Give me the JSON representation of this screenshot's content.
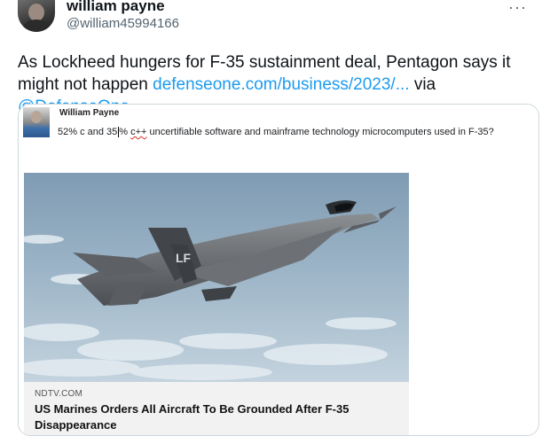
{
  "author": {
    "display_name": "william payne",
    "handle": "@william45994166",
    "more_label": "···"
  },
  "tweet": {
    "text_before": "As Lockheed hungers for F-35 sustainment deal, Pentagon says it might not happen ",
    "link_text": "defenseone.com/business/2023/...",
    "text_via": " via ",
    "mention": "@DefenseOne"
  },
  "embedded_post": {
    "author_name": "William Payne",
    "text_part1": "52% c and 35",
    "text_part2": "% ",
    "text_misspelled": "c++",
    "text_part3": " uncertifiable software  and mainframe technology microcomputers used in F-35?"
  },
  "card": {
    "domain": "NDTV.COM",
    "title": "US Marines Orders All Aircraft To Be Grounded After F-35 Disappearance",
    "image_icon": "f35-jet-photo",
    "tail_code": "LF"
  },
  "colors": {
    "accent": "#1d9bf0",
    "text": "#0f1419",
    "muted": "#536471",
    "border": "#cfd9de"
  }
}
